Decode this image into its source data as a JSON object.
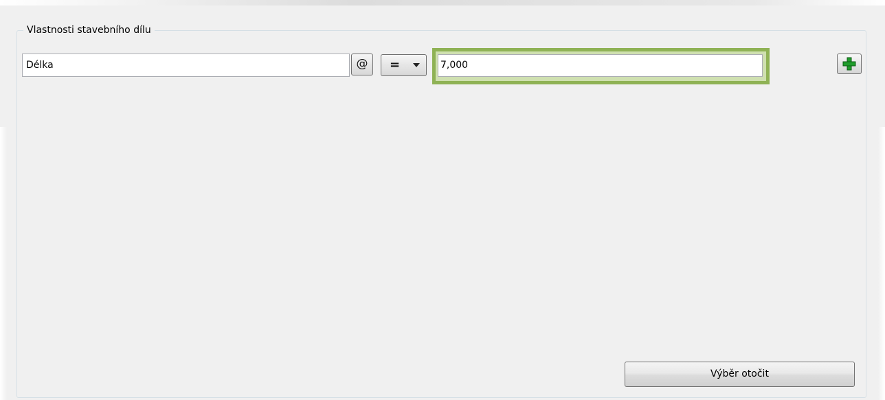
{
  "group": {
    "title": "Vlastnosti stavebního dílu"
  },
  "property_row": {
    "name_value": "Délka",
    "at_button_label": "@",
    "operator_value": "=",
    "value_value": "7,000",
    "add_icon": "plus-icon"
  },
  "actions": {
    "rotate_selection_label": "Výběr otočit"
  },
  "colors": {
    "highlight_border": "#8fb255",
    "plus_green": "#1f9d2b"
  }
}
